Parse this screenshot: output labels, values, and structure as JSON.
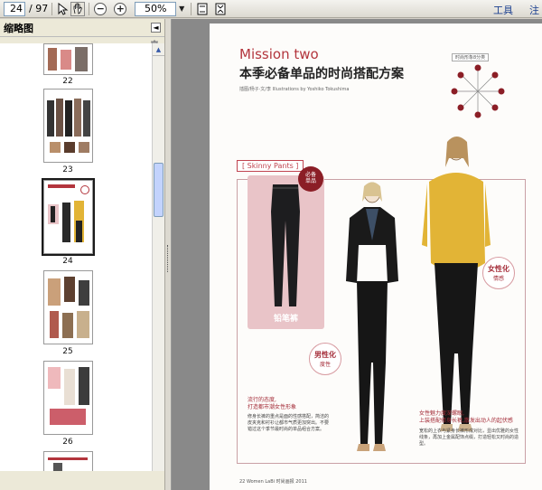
{
  "toolbar": {
    "page_current": "24",
    "page_total": "/ 97",
    "zoom_value": "50%",
    "tools_label": "工具",
    "comment_label": "注"
  },
  "sidebar": {
    "title": "缩略图",
    "thumbnails": [
      {
        "label": "22"
      },
      {
        "label": "23"
      },
      {
        "label": "24",
        "selected": true
      },
      {
        "label": "25"
      },
      {
        "label": "26"
      }
    ]
  },
  "document": {
    "mission": "Mission two",
    "headline": "本季必备单品的时尚搭配方案",
    "credit": "插图/杨子·文/李   Illustrations by Yoshiko Tokushima",
    "wheel_title": "时尚形象8分类",
    "wheel_labels": [
      "生动",
      "可爱",
      "华丽",
      "优雅",
      "知性",
      "冷酷",
      "民族",
      "浪漫"
    ],
    "skinny_label": "[ Skinny Pants ]",
    "must_badge": "必备\n单品",
    "pants_caption": "铅笔裤",
    "note_left_title": "男性化",
    "note_left_sub": "度性",
    "note_right_title": "女性化",
    "note_right_sub": "情感",
    "left_text_title": "流行的态度,\n打造都市潮女性形象",
    "left_text_body": "修身长裤的重点是面的性感搭配，简洁的皮夹克和衬衫让都市气质更加突出。不要错过这个季节最时尚的单品组合方案。",
    "right_text_title": "女性魅力度深螺眼,\n上装搭配修身长裤,散发出动人的起伏感",
    "right_text_body": "宽松的上衣与紧身长裤形成对比，显出优雅的女性线条，再加上金属配饰点缀，打造轻松又时尚的造型。",
    "footer": "22   Women LaBi 时尚画报 2011"
  }
}
